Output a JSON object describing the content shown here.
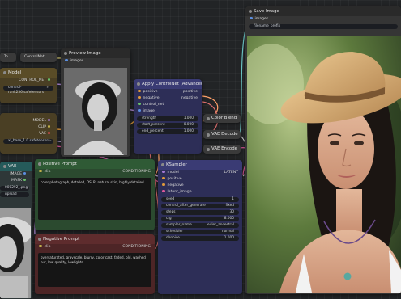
{
  "colors": {
    "canvas": "#222426",
    "node_body": "#353535",
    "node_title": "#2a2a2a",
    "brown_node": "#4a3f24",
    "green_node": "#2b4a2f",
    "red_node": "#4d2526",
    "purple_node": "#2d2e57",
    "accent_wire": "#c3b86a"
  },
  "nodes": {
    "load_image_partial": {
      "title": "VAE",
      "image": "IMAGE",
      "mask": "MASK",
      "file": "000292_.png",
      "upload": "upload"
    },
    "to_cnet": {
      "title_left": "To",
      "title_right": "ControlNet"
    },
    "controlnet_loader": {
      "title": "Model",
      "output": "CONTROL_NET",
      "file": "control-rank256.safetensors"
    },
    "checkpoint_loader": {
      "outputs": [
        "MODEL",
        "CLIP",
        "VAE"
      ],
      "file": "xl_base_1.0.safetensors"
    },
    "preview_image": {
      "title": "Preview Image",
      "input": "images"
    },
    "apply_controlnet": {
      "title": "Apply ControlNet (Advanced)",
      "inputs": [
        "positive",
        "negative",
        "control_net",
        "image"
      ],
      "outputs": [
        "positive",
        "negative"
      ],
      "widgets": [
        {
          "label": "strength",
          "value": "1.000"
        },
        {
          "label": "start_percent",
          "value": "0.000"
        },
        {
          "label": "end_percent",
          "value": "1.000"
        }
      ]
    },
    "color_blend": {
      "title": "Color Blend"
    },
    "vae_decode": {
      "title": "VAE Decode"
    },
    "vae_encode": {
      "title": "VAE Encode"
    },
    "positive_prompt": {
      "title": "Positive Prompt",
      "input": "clip",
      "output": "CONDITIONING",
      "text": "color photograph, detailed, DSLR, natural skin, highly detailed"
    },
    "negative_prompt": {
      "title": "Negative Prompt",
      "input": "clip",
      "output": "CONDITIONING",
      "text": "oversaturated, grayscale, blurry, color cast, faded, old, washed out, low quality, lowlights"
    },
    "ksampler": {
      "title": "KSampler",
      "inputs": [
        "model",
        "positive",
        "negative",
        "latent_image"
      ],
      "output": "LATENT",
      "widgets": [
        {
          "label": "seed",
          "value": "1"
        },
        {
          "label": "control_after_generate",
          "value": "fixed"
        },
        {
          "label": "steps",
          "value": "30"
        },
        {
          "label": "cfg",
          "value": "8.000"
        },
        {
          "label": "sampler_name",
          "value": "euler_ancestral"
        },
        {
          "label": "scheduler",
          "value": "normal"
        },
        {
          "label": "denoise",
          "value": "1.000"
        }
      ]
    },
    "save_image": {
      "title": "Save Image",
      "input": "images",
      "prefix": "filename_prefix"
    }
  }
}
